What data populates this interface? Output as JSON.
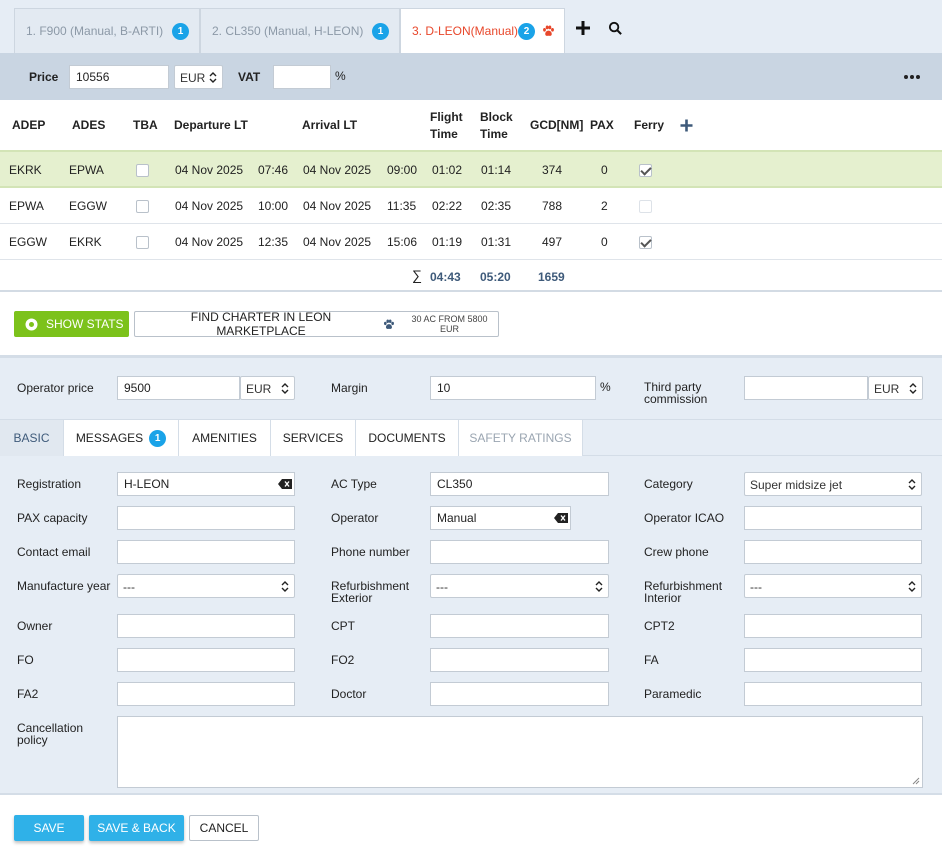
{
  "tabs": [
    {
      "label": "1. F900 (Manual, B-ARTI)",
      "badge": "1"
    },
    {
      "label": "2. CL350 (Manual, H-LEON)",
      "badge": "1"
    },
    {
      "label": "3. D-LEON(Manual)",
      "badge": "2"
    }
  ],
  "price_bar": {
    "price_label": "Price",
    "price_value": "10556",
    "currency": "EUR",
    "vat_label": "VAT",
    "vat_value": "",
    "vat_unit": "%"
  },
  "legs_table": {
    "headers": {
      "adep": "ADEP",
      "ades": "ADES",
      "tba": "TBA",
      "departure": "Departure LT",
      "arrival": "Arrival LT",
      "flight_time_1": "Flight",
      "flight_time_2": "Time",
      "block_time_1": "Block",
      "block_time_2": "Time",
      "gcd": "GCD[NM]",
      "pax": "PAX",
      "ferry": "Ferry"
    },
    "rows": [
      {
        "adep": "EKRK",
        "ades": "EPWA",
        "tba": false,
        "dep_date": "04 Nov 2025",
        "dep_time": "07:46",
        "arr_date": "04 Nov 2025",
        "arr_time": "09:00",
        "flight_time": "01:02",
        "block_time": "01:14",
        "gcd": "374",
        "pax": "0",
        "ferry": true
      },
      {
        "adep": "EPWA",
        "ades": "EGGW",
        "tba": false,
        "dep_date": "04 Nov 2025",
        "dep_time": "10:00",
        "arr_date": "04 Nov 2025",
        "arr_time": "11:35",
        "flight_time": "02:22",
        "block_time": "02:35",
        "gcd": "788",
        "pax": "2",
        "ferry": false
      },
      {
        "adep": "EGGW",
        "ades": "EKRK",
        "tba": false,
        "dep_date": "04 Nov 2025",
        "dep_time": "12:35",
        "arr_date": "04 Nov 2025",
        "arr_time": "15:06",
        "flight_time": "01:19",
        "block_time": "01:31",
        "gcd": "497",
        "pax": "0",
        "ferry": true
      }
    ],
    "totals": {
      "sigma": "∑",
      "flight_time": "04:43",
      "block_time": "05:20",
      "gcd": "1659"
    }
  },
  "stats": {
    "show_stats_label": "SHOW STATS",
    "find_charter_label": "FIND CHARTER IN LEON MARKETPLACE",
    "find_charter_hint": "30 AC FROM 5800 EUR"
  },
  "operator": {
    "operator_price_label": "Operator price",
    "operator_price_value": "9500",
    "operator_currency": "EUR",
    "margin_label": "Margin",
    "margin_value": "10",
    "margin_unit": "%",
    "third_party_label_1": "Third party",
    "third_party_label_2": "commission",
    "third_party_value": "",
    "third_party_currency": "EUR"
  },
  "detail_tabs": {
    "basic": "BASIC",
    "messages": "MESSAGES",
    "messages_badge": "1",
    "amenities": "AMENITIES",
    "services": "SERVICES",
    "documents": "DOCUMENTS",
    "safety_ratings": "SAFETY RATINGS"
  },
  "basic_form": {
    "registration_label": "Registration",
    "registration_value": "H-LEON",
    "ac_type_label": "AC Type",
    "ac_type_value": "CL350",
    "category_label": "Category",
    "category_value": "Super midsize jet",
    "pax_capacity_label": "PAX capacity",
    "pax_capacity_value": "",
    "operator_label": "Operator",
    "operator_value": "Manual",
    "operator_icao_label": "Operator ICAO",
    "operator_icao_value": "",
    "contact_email_label": "Contact email",
    "contact_email_value": "",
    "phone_label": "Phone number",
    "phone_value": "",
    "crew_phone_label": "Crew phone",
    "crew_phone_value": "",
    "manufacture_year_label": "Manufacture year",
    "manufacture_year_value": "---",
    "refurb_ext_label_1": "Refurbishment",
    "refurb_ext_label_2": "Exterior",
    "refurb_ext_value": "---",
    "refurb_int_label_1": "Refurbishment",
    "refurb_int_label_2": "Interior",
    "refurb_int_value": "---",
    "owner_label": "Owner",
    "owner_value": "",
    "cpt_label": "CPT",
    "cpt_value": "",
    "cpt2_label": "CPT2",
    "cpt2_value": "",
    "fo_label": "FO",
    "fo_value": "",
    "fo2_label": "FO2",
    "fo2_value": "",
    "fa_label": "FA",
    "fa_value": "",
    "fa2_label": "FA2",
    "fa2_value": "",
    "doctor_label": "Doctor",
    "doctor_value": "",
    "paramedic_label": "Paramedic",
    "paramedic_value": "",
    "cancellation_label_1": "Cancellation",
    "cancellation_label_2": "policy",
    "cancellation_value": ""
  },
  "footer": {
    "save_label": "SAVE",
    "save_back_label": "SAVE & BACK",
    "cancel_label": "CANCEL"
  },
  "icons": {
    "add": "plus-icon",
    "search": "search-icon",
    "more": "more-dots-icon",
    "paw": "paw-icon",
    "clear": "clear-input-icon",
    "caret": "select-caret-icon"
  },
  "colors": {
    "accent_blue": "#2fb1e8",
    "badge_blue": "#1aa3e8",
    "active_tab_red": "#e8472b",
    "green_button": "#7cc21b",
    "selected_row": "#e5f0cf",
    "totals_blue": "#3e5a7a"
  }
}
